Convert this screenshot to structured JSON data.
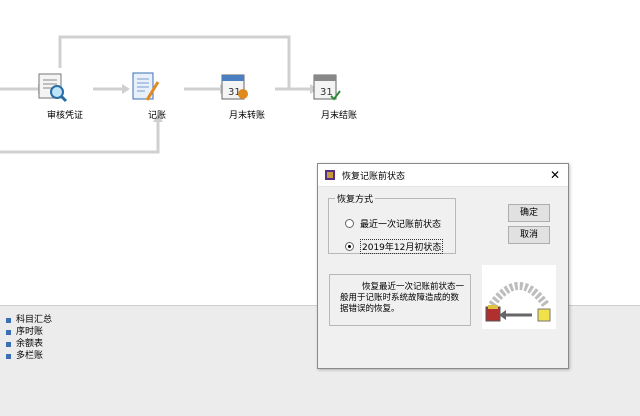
{
  "flow": {
    "nodes": [
      {
        "label": "审核凭证",
        "icon": "voucher-review-icon"
      },
      {
        "label": "记账",
        "icon": "bookkeeping-icon"
      },
      {
        "label": "月末转账",
        "icon": "month-end-transfer-icon"
      },
      {
        "label": "月末结账",
        "icon": "month-end-close-icon"
      }
    ]
  },
  "bottom_list": [
    "科目汇总",
    "序时账",
    "余额表",
    "多栏账"
  ],
  "dialog": {
    "title": "恢复记账前状态",
    "close_glyph": "✕",
    "group_label": "恢复方式",
    "options": [
      {
        "label": "最近一次记账前状态",
        "selected": false
      },
      {
        "label": "2019年12月初状态",
        "selected": true
      }
    ],
    "ok_label": "确定",
    "cancel_label": "取消",
    "description": "恢复最近一次记账前状态一般用于记账时系统故障造成的数据错误的恢复。"
  },
  "colors": {
    "accent": "#3a6fb5",
    "flow_line": "#d0d0d0"
  }
}
